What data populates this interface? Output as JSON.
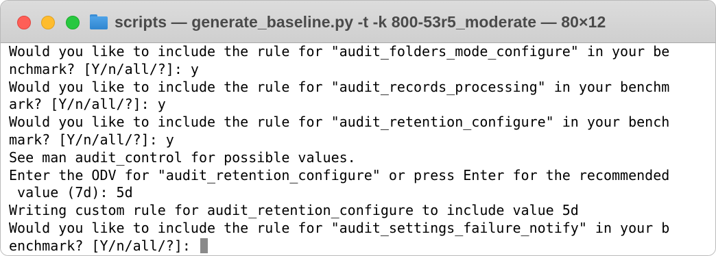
{
  "window": {
    "title": "scripts — generate_baseline.py -t -k 800-53r5_moderate — 80×12",
    "icon": "folder-icon"
  },
  "terminal": {
    "lines": [
      "Would you like to include the rule for \"audit_folders_mode_configure\" in your be",
      "nchmark? [Y/n/all/?]: y",
      "Would you like to include the rule for \"audit_records_processing\" in your benchm",
      "ark? [Y/n/all/?]: y",
      "Would you like to include the rule for \"audit_retention_configure\" in your bench",
      "mark? [Y/n/all/?]: y",
      "See man audit_control for possible values.",
      "Enter the ODV for \"audit_retention_configure\" or press Enter for the recommended",
      " value (7d): 5d",
      "Writing custom rule for audit_retention_configure to include value 5d",
      "Would you like to include the rule for \"audit_settings_failure_notify\" in your b",
      "enchmark? [Y/n/all/?]: "
    ]
  },
  "colors": {
    "close": "#fe5f57",
    "minimize": "#febc2e",
    "maximize": "#28c840",
    "folder": "#3a8ed6",
    "cursor": "#8a8a8a"
  }
}
